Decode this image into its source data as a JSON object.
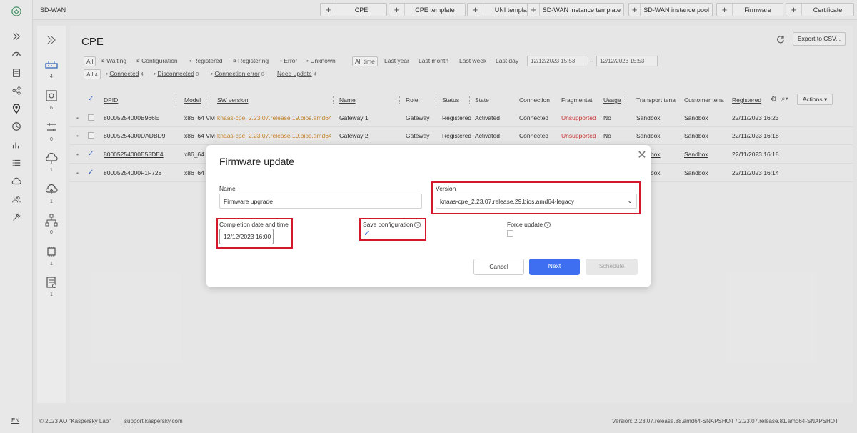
{
  "app": {
    "name": "SD-WAN"
  },
  "top_tabs": [
    "CPE",
    "CPE template",
    "UNI template",
    "SD-WAN instance template",
    "SD-WAN instance pool",
    "Firmware",
    "Certificate"
  ],
  "rail2_counts": [
    "4",
    "6",
    "0",
    "1",
    "1",
    "0",
    "1",
    "1"
  ],
  "page": {
    "title": "CPE",
    "export_label": "Export to CSV...",
    "filters_state": [
      "All",
      "Waiting",
      "Configuration",
      "Registered",
      "Registering",
      "Error",
      "Unknown"
    ],
    "filters_time": [
      "All time",
      "Last year",
      "Last month",
      "Last week",
      "Last day"
    ],
    "date_from": "12/12/2023 15:53",
    "date_sep": "–",
    "date_to": "12/12/2023 15:53",
    "filters_conn": [
      {
        "label": "All",
        "count": "4"
      },
      {
        "label": "Connected",
        "count": "4"
      },
      {
        "label": "Disconnected",
        "count": "0"
      },
      {
        "label": "Connection error",
        "count": "0"
      },
      {
        "label": "Need update",
        "count": "4"
      }
    ],
    "columns": [
      "DPID",
      "Model",
      "SW version",
      "Name",
      "Role",
      "Status",
      "State",
      "Connection",
      "Fragmentati",
      "Usage",
      "Transport tena",
      "Customer tena",
      "Registered"
    ],
    "actions_label": "Actions ▾",
    "rows": [
      {
        "checked": false,
        "dpid": "80005254000B966E",
        "model": "x86_64 VM",
        "sw": "knaas-cpe_2.23.07.release.19.bios.amd64",
        "name": "Gateway 1",
        "role": "Gateway",
        "status": "Registered",
        "state": "Activated",
        "conn": "Connected",
        "frag": "Unsupported",
        "usage": "No",
        "transport": "Sandbox",
        "customer": "Sandbox",
        "registered": "22/11/2023 16:23"
      },
      {
        "checked": false,
        "dpid": "80005254000DADBD9",
        "model": "x86_64 VM",
        "sw": "knaas-cpe_2.23.07.release.19.bios.amd64",
        "name": "Gateway 2",
        "role": "Gateway",
        "status": "Registered",
        "state": "Activated",
        "conn": "Connected",
        "frag": "Unsupported",
        "usage": "No",
        "transport": "Sandbox",
        "customer": "Sandbox",
        "registered": "22/11/2023 16:18"
      },
      {
        "checked": true,
        "dpid": "80005254000E55DE4",
        "model": "x86_64",
        "sw": "",
        "name": "",
        "role": "",
        "status": "",
        "state": "",
        "conn": "",
        "frag": "",
        "usage": "",
        "transport": "Sandbox",
        "customer": "Sandbox",
        "registered": "22/11/2023 16:18"
      },
      {
        "checked": true,
        "dpid": "80005254000F1F728",
        "model": "x86_64",
        "sw": "",
        "name": "",
        "role": "",
        "status": "",
        "state": "",
        "conn": "",
        "frag": "",
        "usage": "",
        "transport": "Sandbox",
        "customer": "Sandbox",
        "registered": "22/11/2023 16:14"
      }
    ]
  },
  "modal": {
    "title": "Firmware update",
    "name_label": "Name",
    "name_value": "Firmware upgrade",
    "version_label": "Version",
    "version_value": "knaas-cpe_2.23.07.release.29.bios.amd64-legacy",
    "completion_label": "Completion date and time",
    "completion_value": "12/12/2023 16:00",
    "save_label": "Save configuration",
    "force_label": "Force update",
    "cancel_label": "Cancel",
    "next_label": "Next",
    "schedule_label": "Schedule"
  },
  "footer": {
    "lang": "EN",
    "copyright": "© 2023 AO \"Kaspersky Lab\"",
    "support": "support.kaspersky.com",
    "version": "Version: 2.23.07.release.88.amd64-SNAPSHOT / 2.23.07.release.81.amd64-SNAPSHOT"
  },
  "colors": {
    "accent": "#3d6ff0",
    "highlight": "#d3182b",
    "version_text": "#d08a2e",
    "unsupported": "#d63b3b"
  }
}
